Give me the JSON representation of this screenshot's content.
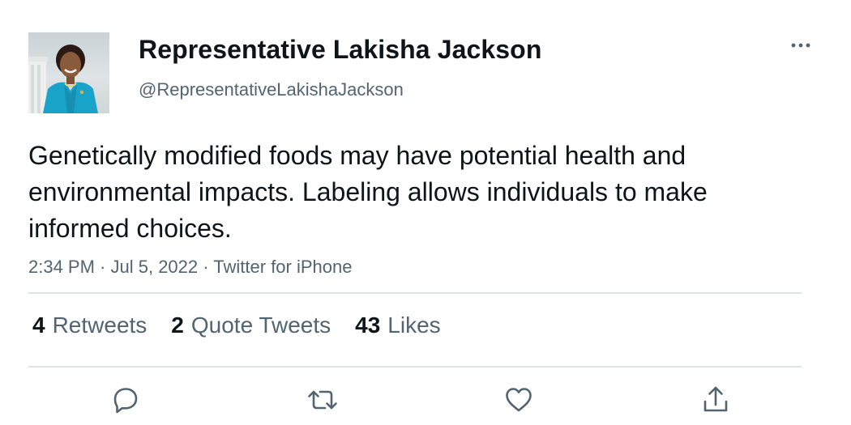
{
  "author": {
    "display_name": "Representative Lakisha Jackson",
    "handle": "@RepresentativeLakishaJackson"
  },
  "tweet": {
    "text": "Genetically modified foods may have potential health and environmental impacts. Labeling allows individuals to make informed choices."
  },
  "meta": {
    "time": "2:34 PM",
    "separator": " · ",
    "date": "Jul 5, 2022",
    "source": "Twitter for iPhone"
  },
  "stats": {
    "retweets": {
      "count": "4",
      "label": "Retweets"
    },
    "quotes": {
      "count": "2",
      "label": "Quote Tweets"
    },
    "likes": {
      "count": "43",
      "label": "Likes"
    }
  },
  "icons": {
    "more": "more-horizontal-icon",
    "reply": "reply-bubble-icon",
    "retweet": "retweet-arrows-icon",
    "like": "heart-icon",
    "share": "share-upload-icon"
  },
  "colors": {
    "text_primary": "#0f1419",
    "text_secondary": "#536471",
    "divider": "#dde3e6",
    "avatar_jacket": "#1aa3c8"
  }
}
